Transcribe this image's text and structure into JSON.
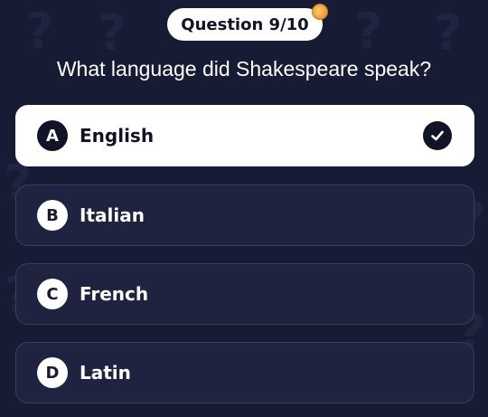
{
  "background_glyph": "?",
  "header": {
    "question_counter": "Question 9/10",
    "coin_icon": "coin-icon"
  },
  "question": {
    "text": "What language did Shakespeare speak?"
  },
  "options": [
    {
      "letter": "A",
      "label": "English",
      "selected": true
    },
    {
      "letter": "B",
      "label": "Italian",
      "selected": false
    },
    {
      "letter": "C",
      "label": "French",
      "selected": false
    },
    {
      "letter": "D",
      "label": "Latin",
      "selected": false
    }
  ],
  "colors": {
    "background": "#171b33",
    "option_bg": "#1f2340",
    "selected_bg": "#ffffff",
    "accent_coin": "#f0a43c"
  }
}
